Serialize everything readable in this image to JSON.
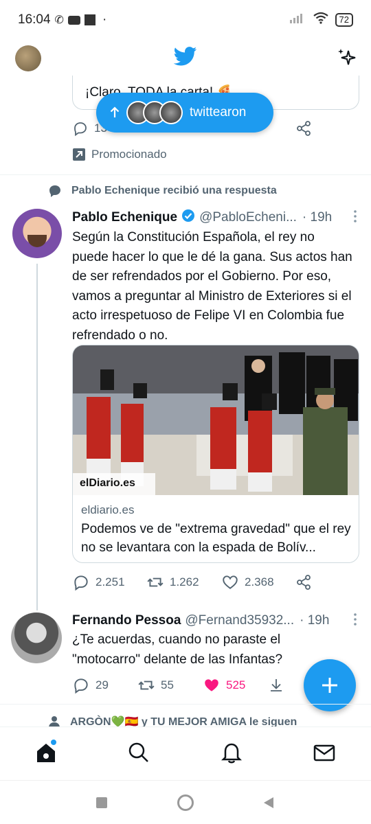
{
  "status_bar": {
    "time": "16:04",
    "battery": "72"
  },
  "prev_tweet": {
    "text_fragment": "¡Claro, TODA la carta! 🍕",
    "reply_count": "13",
    "promoted_label": "Promocionado"
  },
  "new_tweets_pill": {
    "label": "twittearon"
  },
  "main_tweet": {
    "context": "Pablo Echenique recibió una respuesta",
    "author_name": "Pablo Echenique",
    "handle": "@PabloEcheni...",
    "time": "· 19h",
    "text": "Según la Constitución Española, el rey no puede hacer lo que le dé la gana. Sus actos han de ser refrendados por el Gobierno. Por eso, vamos a preguntar al Ministro de Exteriores si el acto irrespetuoso de Felipe VI en Colombia fue refrendado o no.",
    "card": {
      "image_logo": "elDiario.es",
      "domain": "eldiario.es",
      "title": "Podemos ve de \"extrema gravedad\" que el rey no se levantara con la espada de Bolív..."
    },
    "replies": "2.251",
    "retweets": "1.262",
    "likes": "2.368"
  },
  "reply_tweet": {
    "author_name": "Fernando Pessoa",
    "handle": "@Fernand35932...",
    "time": "· 19h",
    "text": "¿Te acuerdas, cuando no paraste el \"motocarro\" delante de las Infantas?",
    "replies": "29",
    "retweets": "55",
    "likes": "525"
  },
  "next_context": "ARGÒN💚🇪🇸 y TU MEJOR AMIGA le siguen",
  "colors": {
    "accent": "#1d9bf0",
    "like": "#f91880",
    "muted": "#536471"
  }
}
